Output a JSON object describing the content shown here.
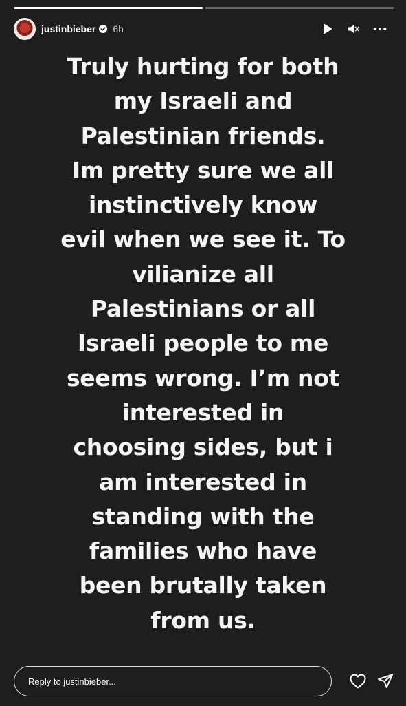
{
  "progress": [
    {
      "fill": 1.0
    },
    {
      "fill": 0.0
    }
  ],
  "header": {
    "username": "justinbieber",
    "verified": true,
    "timestamp": "6h",
    "icons": [
      "play-icon",
      "mute-icon",
      "more-icon"
    ]
  },
  "story": {
    "text": "Truly hurting for both\nmy Israeli and\nPalestinian friends.\nIm pretty sure we all\ninstinctively know\nevil when we see it. To\nvilianize all\nPalestinians or all\nIsraeli people to me\nseems wrong. I’m not\ninterested in\nchoosing sides, but i\nam interested in\nstanding with the\nfamilies who have\nbeen brutally taken\nfrom us."
  },
  "reply": {
    "placeholder": "Reply to justinbieber..."
  },
  "footer_icons": [
    "heart-icon",
    "send-icon"
  ],
  "colors": {
    "background": "#1e1e1e",
    "text": "#f4f4f4"
  }
}
